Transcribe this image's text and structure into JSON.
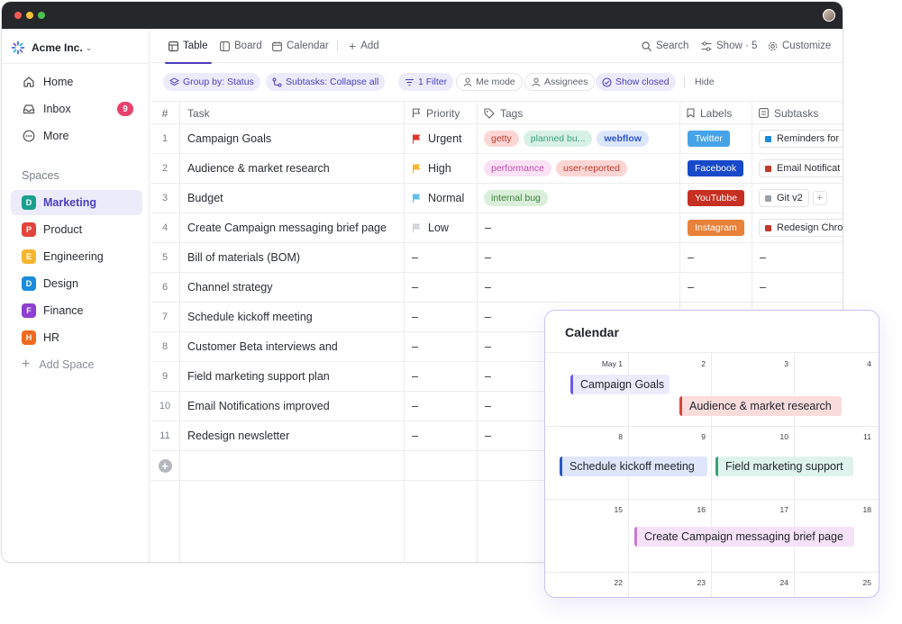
{
  "workspace": {
    "name": "Acme Inc.",
    "chevron": "⌄"
  },
  "nav": [
    {
      "label": "Home",
      "icon": "home-icon"
    },
    {
      "label": "Inbox",
      "icon": "inbox-icon",
      "badge": "9"
    },
    {
      "label": "More",
      "icon": "more-icon"
    }
  ],
  "spaces": {
    "title": "Spaces",
    "items": [
      {
        "letter": "D",
        "label": "Marketing",
        "color": "#1aa08d",
        "active": true
      },
      {
        "letter": "P",
        "label": "Product",
        "color": "#e2443b"
      },
      {
        "letter": "E",
        "label": "Engineering",
        "color": "#f5b731"
      },
      {
        "letter": "D",
        "label": "Design",
        "color": "#1b8cde"
      },
      {
        "letter": "F",
        "label": "Finance",
        "color": "#8e3fd1"
      },
      {
        "letter": "H",
        "label": "HR",
        "color": "#f06a1d"
      }
    ],
    "add_label": "Add Space"
  },
  "views": {
    "tabs": [
      {
        "label": "Table",
        "icon": "table-icon",
        "active": true
      },
      {
        "label": "Board",
        "icon": "board-icon"
      },
      {
        "label": "Calendar",
        "icon": "calendar-icon"
      }
    ],
    "add_label": "Add",
    "search_label": "Search",
    "show_label": "Show · 5",
    "customize_label": "Customize"
  },
  "filters": {
    "group_by": "Group by: Status",
    "subtasks": "Subtasks: Collapse all",
    "filter": "1 Filter",
    "me_mode": "Me mode",
    "assignees": "Assignees",
    "show_closed": "Show closed",
    "hide": "Hide"
  },
  "table": {
    "headers": {
      "num": "#",
      "task": "Task",
      "priority": "Priority",
      "tags": "Tags",
      "labels": "Labels",
      "subtasks": "Subtasks"
    },
    "rows": [
      {
        "num": "1",
        "task": "Campaign Goals",
        "priority": "Urgent",
        "flag": "#e0362c",
        "tags": [
          {
            "text": "getty",
            "bg": "#fbd6d4",
            "fg": "#c0392b"
          },
          {
            "text": "planned bu...",
            "bg": "#d8f1e7",
            "fg": "#3aa17a"
          },
          {
            "text": "webflow",
            "bg": "#dce6fb",
            "fg": "#2b56c7"
          }
        ],
        "label": {
          "text": "Twitter",
          "bg": "#46a3e8"
        },
        "subtask": {
          "text": "Reminders for",
          "color": "#1b8cde"
        }
      },
      {
        "num": "2",
        "task": "Audience & market research",
        "priority": "High",
        "flag": "#f5b731",
        "tags": [
          {
            "text": "performance",
            "bg": "#fbe1f5",
            "fg": "#c44fb0"
          },
          {
            "text": "user-reported",
            "bg": "#fbd6d4",
            "fg": "#c0392b"
          }
        ],
        "label": {
          "text": "Facebook",
          "bg": "#1749c9"
        },
        "subtask": {
          "text": "Email Notificat",
          "color": "#c0392b"
        }
      },
      {
        "num": "3",
        "task": "Budget",
        "priority": "Normal",
        "flag": "#5bc0eb",
        "tags": [
          {
            "text": "internal bug",
            "bg": "#d9efd9",
            "fg": "#3d7f3d"
          }
        ],
        "label": {
          "text": "YouTubbe",
          "bg": "#c62f22"
        },
        "subtask": {
          "text": "Git v2",
          "color": "#9aa0a8"
        }
      },
      {
        "num": "4",
        "task": "Create Campaign messaging brief page",
        "priority": "Low",
        "flag": "#c9ccd2",
        "tags": [],
        "tags_empty": "–",
        "label": {
          "text": "Instagram",
          "bg": "#e8813a"
        },
        "subtask": {
          "text": "Redesign Chro",
          "color": "#c0392b"
        }
      },
      {
        "num": "5",
        "task": "Bill of materials (BOM)",
        "empty": "–"
      },
      {
        "num": "6",
        "task": "Channel strategy",
        "empty": "–"
      },
      {
        "num": "7",
        "task": "Schedule kickoff meeting",
        "empty": "–"
      },
      {
        "num": "8",
        "task": "Customer Beta interviews and",
        "empty": "–"
      },
      {
        "num": "9",
        "task": "Field marketing support plan",
        "empty": "–"
      },
      {
        "num": "10",
        "task": "Email Notifications improved",
        "empty": "–"
      },
      {
        "num": "11",
        "task": "Redesign newsletter",
        "empty": "–"
      }
    ],
    "add_subtask": "+",
    "add_row": "+"
  },
  "calendar": {
    "title": "Calendar",
    "days": [
      [
        "May 1",
        "2",
        "3",
        "4"
      ],
      [
        "8",
        "9",
        "10",
        "11"
      ],
      [
        "15",
        "16",
        "17",
        "18"
      ],
      [
        "22",
        "23",
        "24",
        "25"
      ]
    ],
    "events": [
      {
        "text": "Campaign Goals",
        "bg": "#ecebfb",
        "border": "#6b5be0"
      },
      {
        "text": "Audience & market research",
        "bg": "#fbdcdc",
        "border": "#d9443a"
      },
      {
        "text": "Schedule kickoff meeting",
        "bg": "#dfe6fb",
        "border": "#2b56c7"
      },
      {
        "text": "Field marketing support",
        "bg": "#dff3ec",
        "border": "#3aa17a"
      },
      {
        "text": "Create Campaign messaging brief page",
        "bg": "#f6e2f8",
        "border": "#c77ad6"
      }
    ]
  }
}
